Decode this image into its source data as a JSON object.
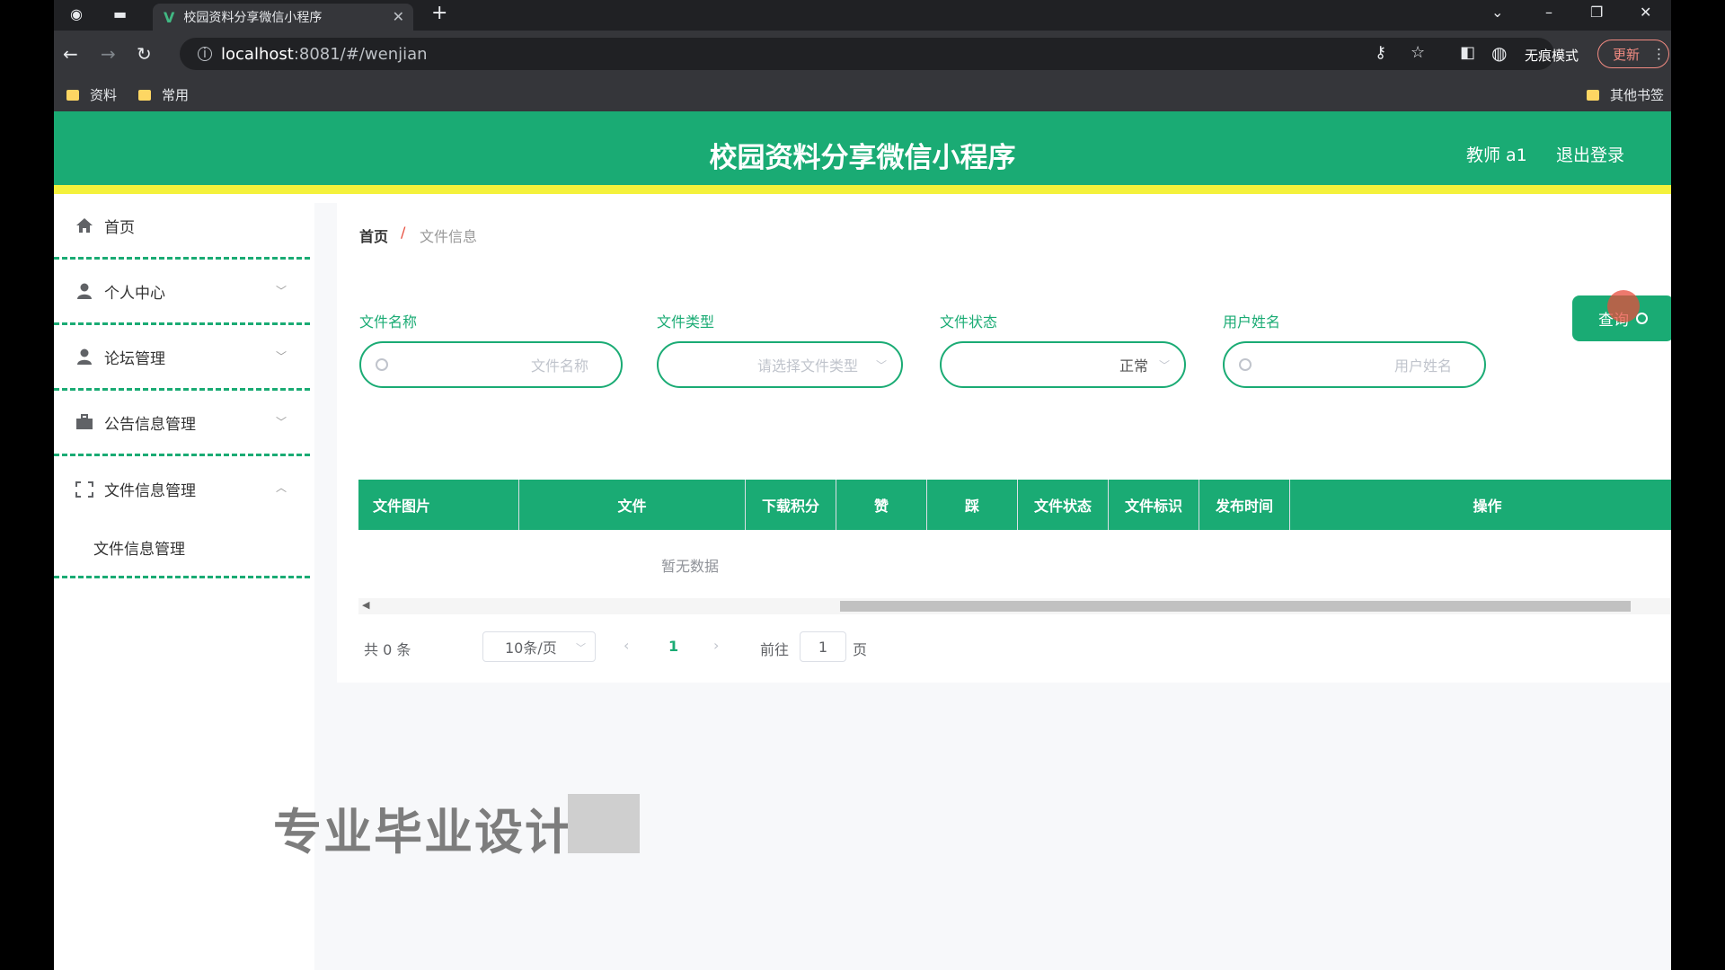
{
  "browser": {
    "tab_title": "校园资料分享微信小程序",
    "url_host": "localhost",
    "url_path": ":8081/#/wenjian",
    "incognito_label": "无痕模式",
    "update_label": "更新",
    "bookmarks": [
      "资料",
      "常用"
    ],
    "other_bookmarks": "其他书签"
  },
  "header": {
    "title": "校园资料分享微信小程序",
    "user": "教师 a1",
    "logout": "退出登录"
  },
  "sidebar": {
    "items": [
      {
        "label": "首页",
        "icon": "home-icon"
      },
      {
        "label": "个人中心",
        "icon": "user-icon"
      },
      {
        "label": "论坛管理",
        "icon": "user-icon"
      },
      {
        "label": "公告信息管理",
        "icon": "briefcase-icon"
      },
      {
        "label": "文件信息管理",
        "icon": "expand-icon"
      }
    ],
    "sub_item": "文件信息管理"
  },
  "breadcrumb": {
    "home": "首页",
    "separator": "/",
    "current": "文件信息"
  },
  "filters": {
    "file_name": {
      "label": "文件名称",
      "placeholder": "文件名称"
    },
    "file_type": {
      "label": "文件类型",
      "placeholder": "请选择文件类型"
    },
    "file_status": {
      "label": "文件状态",
      "value": "正常"
    },
    "user_name": {
      "label": "用户姓名",
      "placeholder": "用户姓名"
    },
    "query_button": "查询"
  },
  "table": {
    "columns": [
      "文件图片",
      "文件",
      "下载积分",
      "赞",
      "踩",
      "文件状态",
      "文件标识",
      "发布时间",
      "操作"
    ],
    "empty_text": "暂无数据"
  },
  "pagination": {
    "total": "共 0 条",
    "page_size": "10条/页",
    "current_page": "1",
    "goto_label": "前往",
    "goto_value": "1",
    "page_suffix": "页"
  },
  "watermark": "专业毕业设计",
  "colors": {
    "accent": "#1aab74",
    "header_border": "#f4f13b"
  }
}
